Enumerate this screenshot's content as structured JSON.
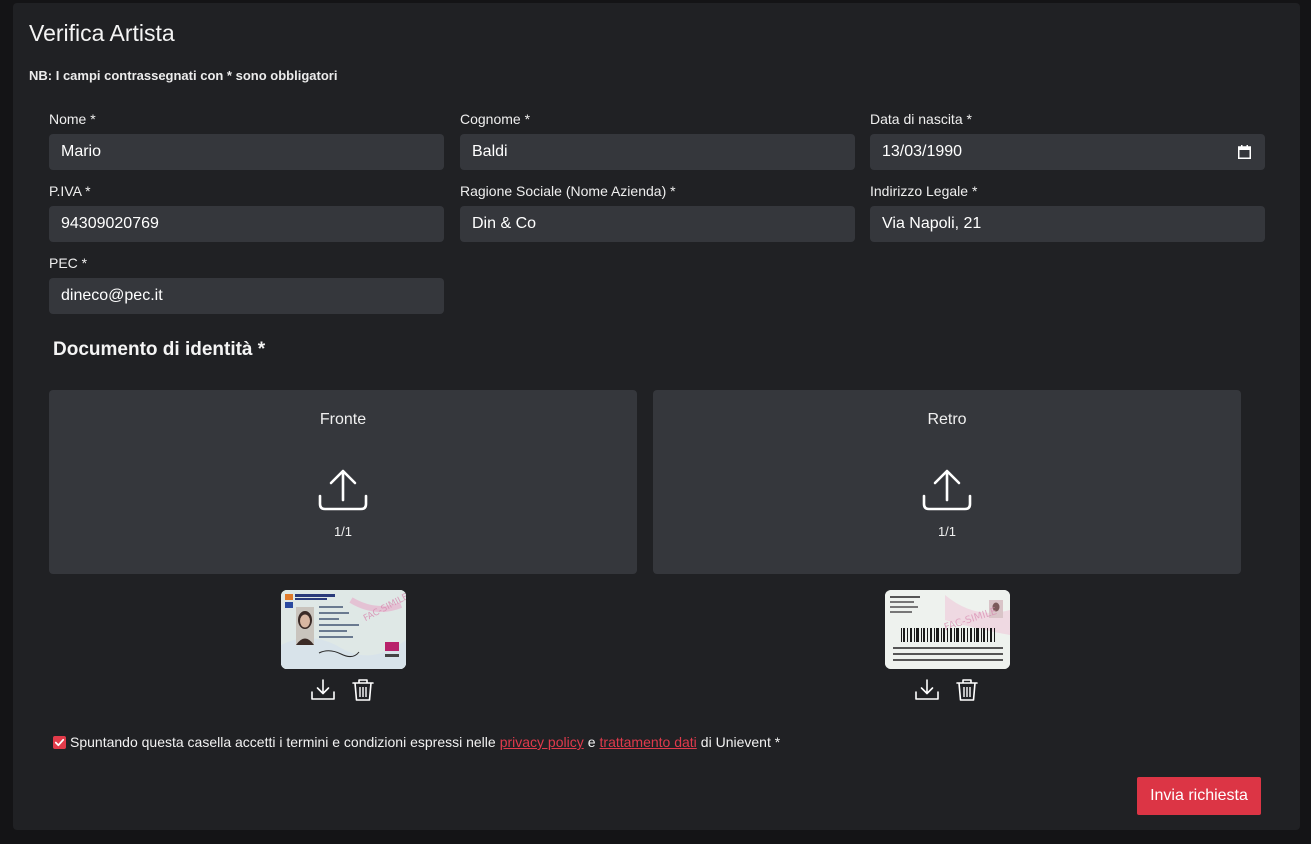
{
  "page": {
    "title": "Verifica Artista",
    "note": "NB: I campi contrassegnati con * sono obbligatori"
  },
  "fields": {
    "nome": {
      "label": "Nome *",
      "value": "Mario"
    },
    "cognome": {
      "label": "Cognome *",
      "value": "Baldi"
    },
    "data_nascita": {
      "label": "Data di nascita *",
      "value": "13/03/1990"
    },
    "piva": {
      "label": "P.IVA *",
      "value": "94309020769"
    },
    "ragione_sociale": {
      "label": "Ragione Sociale (Nome Azienda) *",
      "value": "Din & Co"
    },
    "indirizzo": {
      "label": "Indirizzo Legale *",
      "value": "Via Napoli, 21"
    },
    "pec": {
      "label": "PEC *",
      "value": "dineco@pec.it"
    }
  },
  "documents": {
    "title": "Documento di identità *",
    "front": {
      "label": "Fronte",
      "count": "1/1",
      "icon": "upload-icon"
    },
    "back": {
      "label": "Retro",
      "count": "1/1",
      "icon": "upload-icon"
    },
    "actions": {
      "download_icon": "download-icon",
      "delete_icon": "trash-icon"
    }
  },
  "consent": {
    "checked": true,
    "text_before": "Spuntando questa casella accetti i termini e condizioni espressi nelle",
    "link1": "privacy policy",
    "conjunction": "e",
    "link2": "trattamento dati",
    "text_after": "di Unievent *"
  },
  "submit": {
    "label": "Invia richiesta"
  },
  "colors": {
    "background": "#141416",
    "card": "#202124",
    "input": "#35373c",
    "accent": "#dc3545"
  }
}
